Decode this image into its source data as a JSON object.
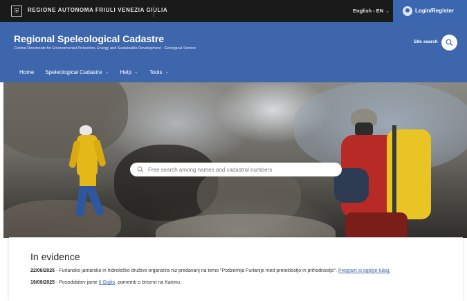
{
  "topbar": {
    "logo_icon": "region-crest-icon",
    "region_name": "REGIONE AUTONOMA FRIULI VENEZIA GIULIA",
    "language": "English - EN",
    "login_label": "Login/Register"
  },
  "header": {
    "title": "Regional Speleological Cadastre",
    "subtitle": "Central Directorate for Environmental Protection, Energy and Sustainable Development - Geological Service",
    "site_search_label": "Site search"
  },
  "nav": {
    "items": [
      {
        "label": "Home",
        "has_dropdown": false
      },
      {
        "label": "Speleological Cadastre",
        "has_dropdown": true
      },
      {
        "label": "Help",
        "has_dropdown": true
      },
      {
        "label": "Tools",
        "has_dropdown": true
      }
    ]
  },
  "hero": {
    "search_placeholder": "Free search among names and cadastral numbers"
  },
  "evidence": {
    "title": "In evidence",
    "items": [
      {
        "date": "22/09/2025",
        "text": " - Furlansko jamarsko in hidrološko društvo organizira niz predavanj na temo \"Podzemlja Furlanije med preteklostjo in prihodnostjo\". ",
        "link": "Program si oglejte tukaj.",
        "after": ""
      },
      {
        "date": "19/09/2025",
        "text": " - Posodobitev jame ",
        "link": "Il Giglio",
        "after": ", pomemb o brezno na Kaninu."
      }
    ]
  },
  "colors": {
    "header_blue": "#3e66ad",
    "topbar_black": "#1a1a1a",
    "login_blue": "#3b66b0"
  }
}
